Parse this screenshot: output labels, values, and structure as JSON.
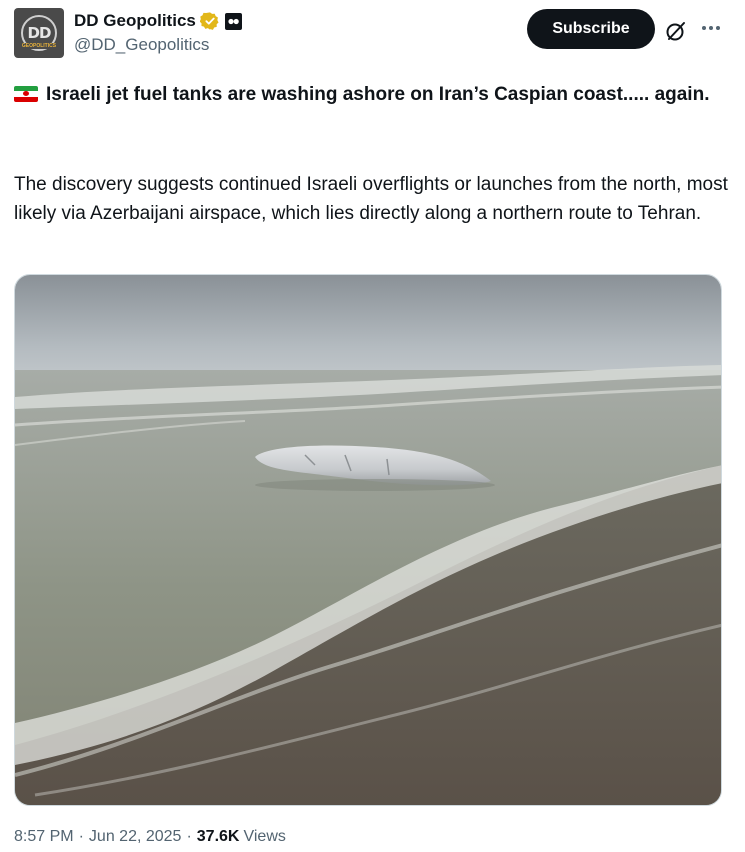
{
  "author": {
    "display_name": "DD Geopolitics",
    "handle": "@DD_Geopolitics",
    "avatar_text": "DD",
    "avatar_subtext": "GEOPOLITICS"
  },
  "actions": {
    "subscribe_label": "Subscribe"
  },
  "post": {
    "headline": "Israeli jet fuel tanks are washing ashore on Iran’s Caspian coast..... again.",
    "body": "The discovery suggests continued Israeli overflights or launches from the north, most likely via Azerbaijani airspace, which lies directly along a northern route to Tehran.",
    "flag_icon": "iran-flag-icon"
  },
  "meta": {
    "time": "8:57 PM",
    "date": "Jun 22, 2025",
    "views_count": "37.6K",
    "views_label": "Views",
    "separator": "·"
  },
  "colors": {
    "text_primary": "#0f1419",
    "text_secondary": "#536471",
    "verified_gold": "#e2b719",
    "button_bg": "#0f1419"
  }
}
